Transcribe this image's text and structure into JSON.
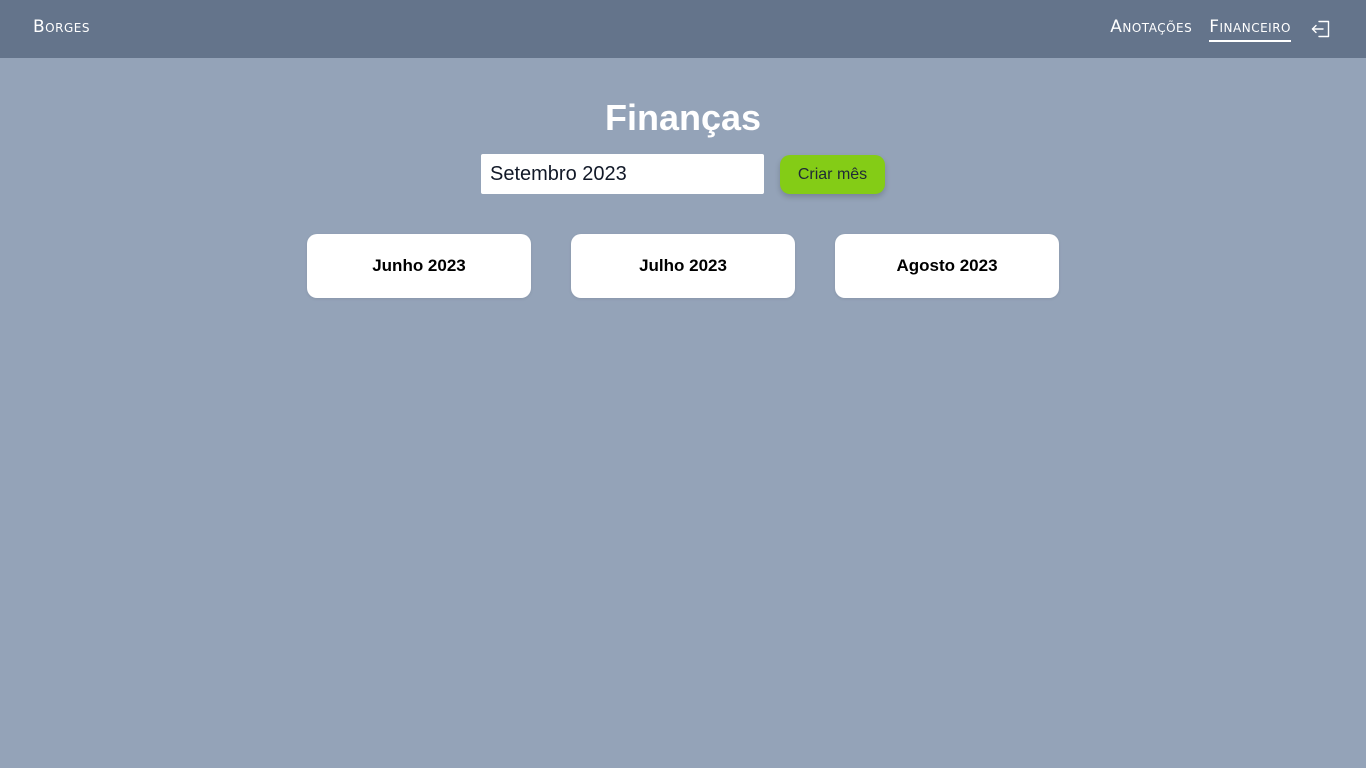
{
  "navbar": {
    "brand": "Borges",
    "links": [
      {
        "label": "Anotações",
        "active": false
      },
      {
        "label": "Financeiro",
        "active": true
      }
    ],
    "logout_icon": "logout-icon",
    "colors": {
      "background": "#64748b",
      "text": "#ffffff"
    }
  },
  "main": {
    "title": "Finanças",
    "month_input": {
      "value": "Setembro 2023",
      "placeholder": ""
    },
    "create_button_label": "Criar mês",
    "months": [
      {
        "label": "Junho 2023"
      },
      {
        "label": "Julho 2023"
      },
      {
        "label": "Agosto 2023"
      }
    ],
    "colors": {
      "background": "#94a3b8",
      "button": "#84cc16",
      "card": "#ffffff"
    }
  }
}
